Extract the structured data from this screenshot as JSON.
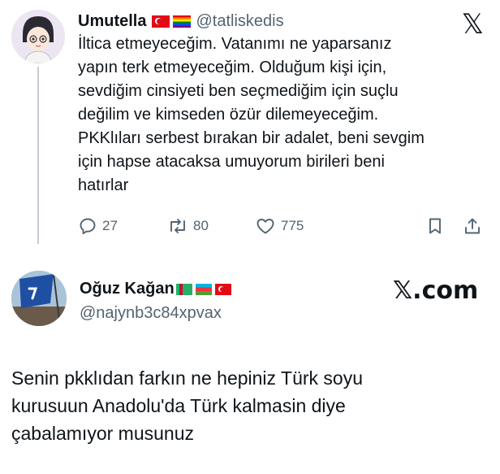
{
  "tweet1": {
    "display_name": "Umutella",
    "handle": "@tatliskedis",
    "badges": [
      "flag-turkey-icon",
      "rainbow-flag-icon"
    ],
    "text_lines": [
      "İltica etmeyeceğim. Vatanımı ne yaparsanız",
      "yapın terk etmeyeceğim. Olduğum kişi için,",
      "sevdiğim cinsiyeti ben seçmediğim için suçlu",
      "değilim ve kimseden özür dilemeyeceğim.",
      "PKKlıları serbest bırakan bir adalet, beni sevgim",
      "için hapse atacaksa umuyorum birileri beni",
      "hatırlar"
    ],
    "stats": {
      "replies": "27",
      "retweets": "80",
      "likes": "775"
    }
  },
  "tweet2": {
    "display_name": "Oğuz Kağan",
    "handle": "@najynb3c84xpvax",
    "badges": [
      "flag-turkmenistan-icon",
      "flag-azerbaijan-icon",
      "flag-turkey-icon"
    ],
    "text_lines": [
      "Senin pkklıdan farkın ne hepiniz Türk soyu",
      "kurusuun Anadolu'da Türk kalmasin diye",
      "çabalamıyor musunuz"
    ],
    "brand": "𝕏.com"
  },
  "brand_logo": "𝕏",
  "colors": {
    "text": "#0f1419",
    "secondary": "#536471",
    "thread_line": "#c5ccd3"
  }
}
